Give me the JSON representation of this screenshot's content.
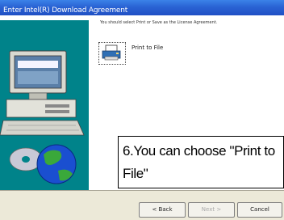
{
  "window": {
    "title": "Enter Intel(R) Download Agreement"
  },
  "instruction": "You should select Print or Save as the License Agreement.",
  "option": {
    "label": "Print to File",
    "icon": "printer-file-icon"
  },
  "callout": {
    "line1": "6.You can choose \"Print to",
    "line2": "File\""
  },
  "buttons": {
    "back": "< Back",
    "next": "Next >",
    "cancel": "Cancel"
  },
  "colors": {
    "title_bar": "#2a63d4",
    "sidebar": "#00838a",
    "dialog_bg": "#ece9d8"
  }
}
